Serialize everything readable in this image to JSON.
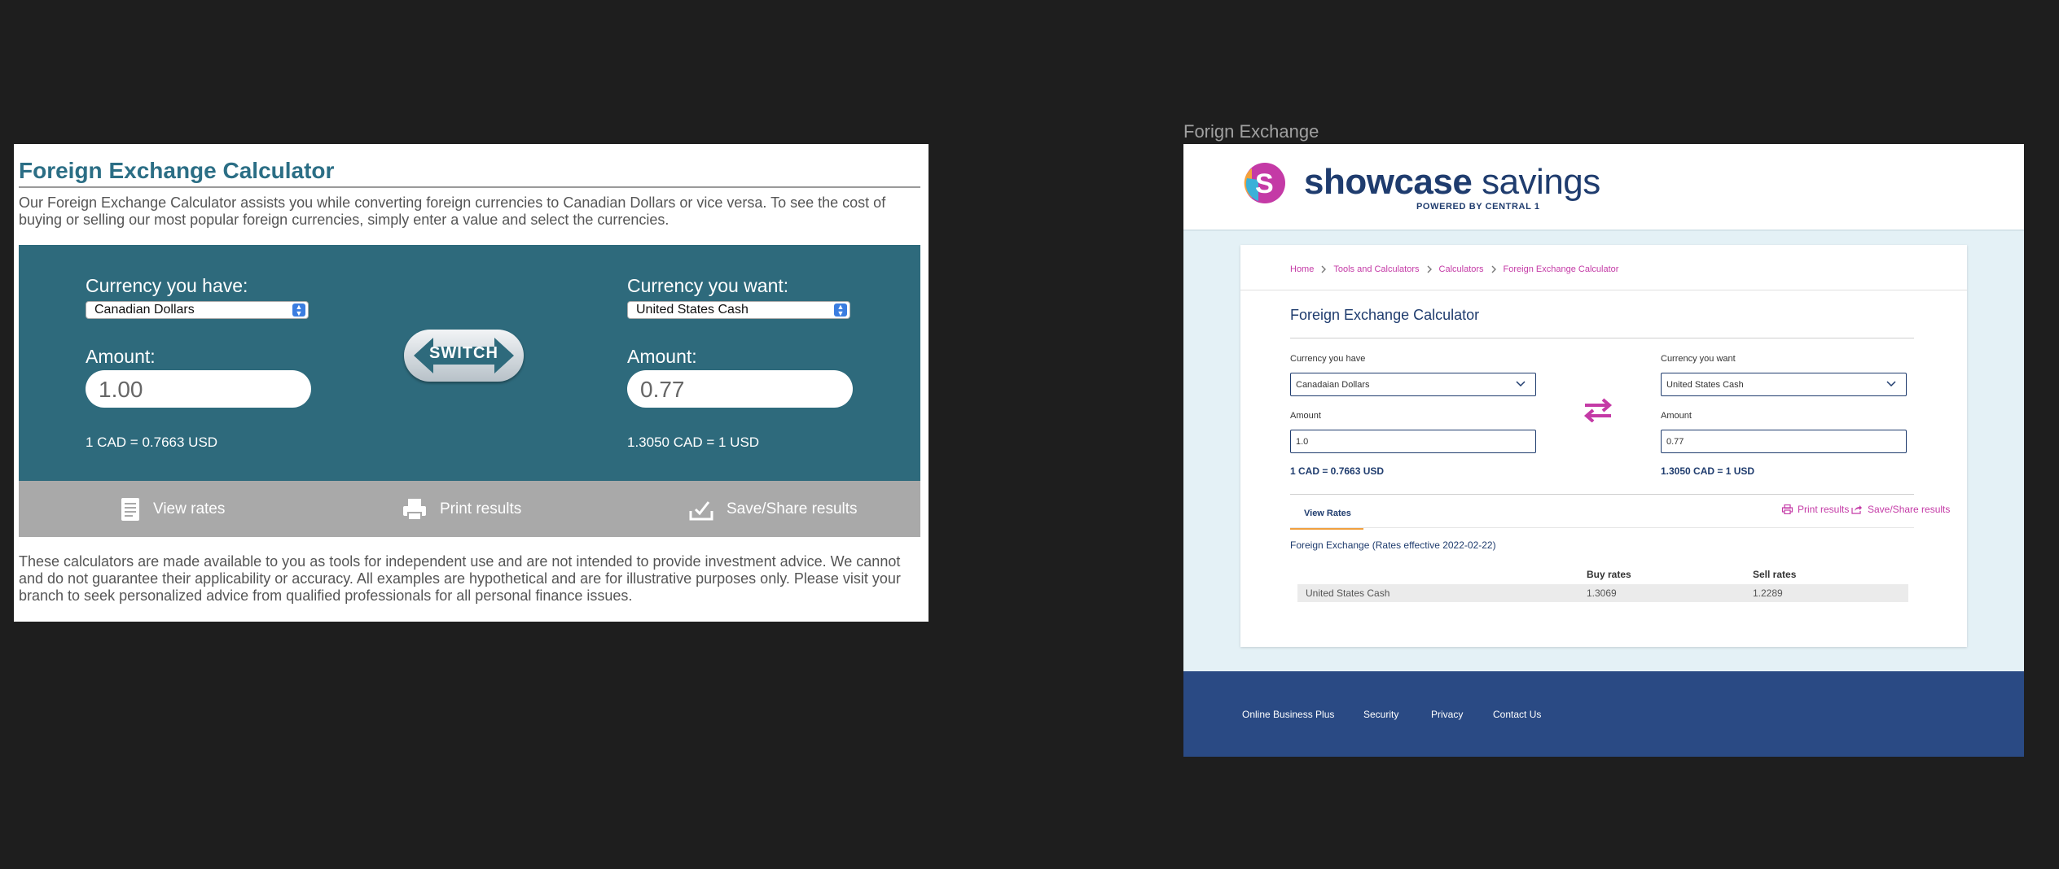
{
  "left": {
    "title": "Foreign Exchange Calculator",
    "intro": "Our Foreign Exchange Calculator assists you while converting foreign currencies to Canadian Dollars or vice versa. To see the cost of buying or selling our most popular foreign currencies, simply enter a value and select the currencies.",
    "have_label": "Currency you have:",
    "have_value": "Canadian Dollars",
    "want_label": "Currency you want:",
    "want_value": "United States Cash",
    "amount_label": "Amount:",
    "amount_have": "1.00",
    "amount_want": "0.77",
    "rate_have": "1 CAD = 0.7663 USD",
    "rate_want": "1.3050 CAD = 1 USD",
    "switch_label": "SWITCH",
    "actions": {
      "view": "View rates",
      "print": "Print results",
      "save": "Save/Share results"
    },
    "disclaimer": "These calculators are made available to you as tools for independent use and are not intended to provide investment advice. We cannot and do not guarantee their applicability or accuracy. All examples are hypothetical and are for illustrative purposes only. Please visit your branch to seek personalized advice from qualified professionals for all personal finance issues."
  },
  "right": {
    "caption": "Forign Exchange",
    "brand_bold": "showcase",
    "brand_light": " savings",
    "powered": "POWERED BY CENTRAL 1",
    "breadcrumbs": [
      "Home",
      "Tools and Calculators",
      "Calculators",
      "Foreign Exchange Calculator"
    ],
    "title": "Foreign Exchange Calculator",
    "have_label": "Currency you have",
    "have_value": "Canadaian Dollars",
    "want_label": "Currency you want",
    "want_value": "United States Cash",
    "amount_label": "Amount",
    "amount_have": "1.0",
    "amount_want": "0.77",
    "rate_have": "1 CAD = 0.7663 USD",
    "rate_want": "1.3050 CAD = 1 USD",
    "tab_view": "View Rates",
    "print": "Print results",
    "save": "Save/Share results",
    "fx_title": "Foreign Exchange (Rates effective 2022-02-22)",
    "table": {
      "headers": [
        "Buy rates",
        "Sell rates"
      ],
      "rows": [
        {
          "currency": "United States Cash",
          "buy": "1.3069",
          "sell": "1.2289"
        }
      ]
    },
    "footer": [
      "Online Business Plus",
      "Security",
      "Privacy",
      "Contact Us"
    ]
  },
  "colors": {
    "teal_title": "#2b6e85",
    "calc_bg": "#2e6a7c",
    "action_bar": "#a9a9a9",
    "navy": "#1f3c6e",
    "magenta": "#c43aa6",
    "footer": "#2a4a84",
    "tab_underline": "#f0a040"
  },
  "icons": [
    "view-rates-icon",
    "print-icon",
    "save-share-icon",
    "switch-arrow-icon",
    "swap-arrows-icon",
    "chevron-down-icon",
    "chevron-right-icon",
    "logo-mark-icon"
  ]
}
